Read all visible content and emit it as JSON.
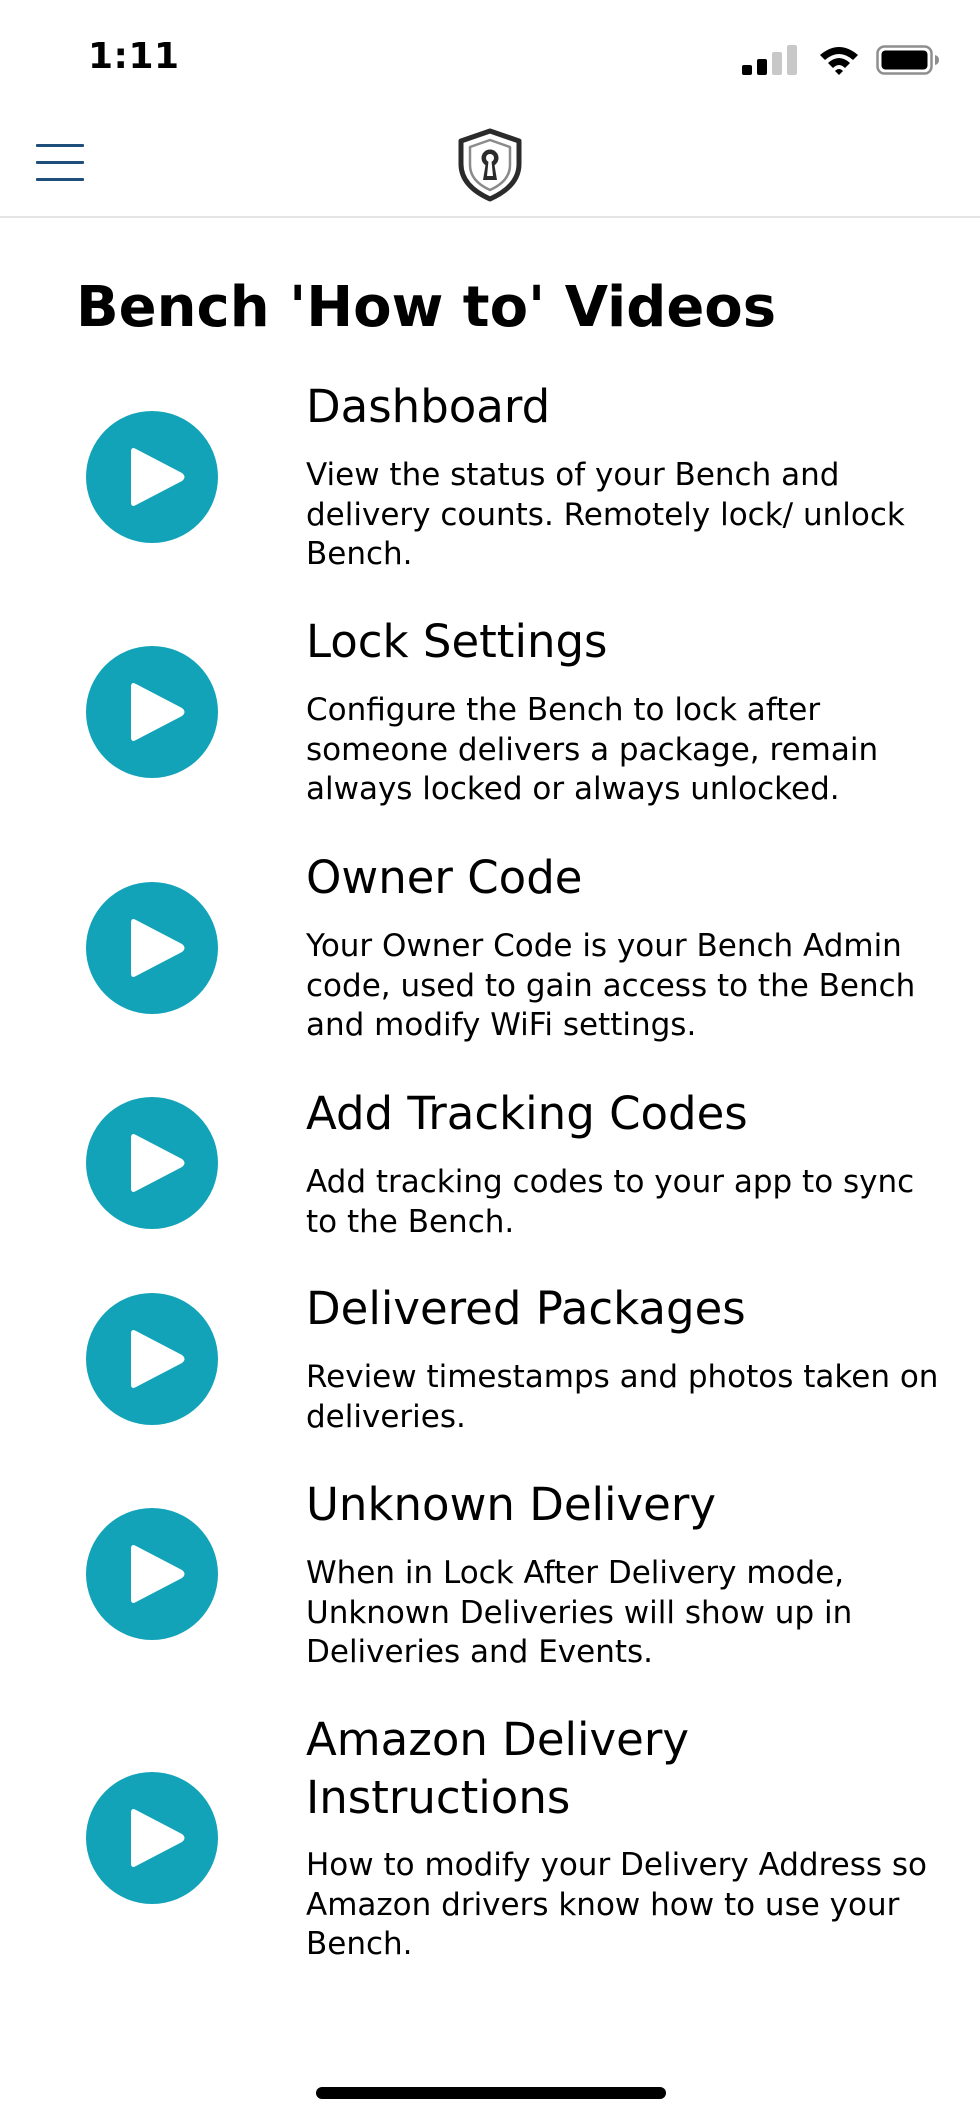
{
  "status_bar": {
    "time": "1:11"
  },
  "header": {
    "menu_icon": "hamburger-menu-icon",
    "logo_icon": "shield-keyhole-logo-icon"
  },
  "page": {
    "title": "Bench 'How to' Videos"
  },
  "colors": {
    "accent": "#12a3b8",
    "menu": "#1d4f7a"
  },
  "videos": [
    {
      "title": "Dashboard",
      "description": "View the status of your Bench and delivery counts. Remotely lock/ unlock Bench."
    },
    {
      "title": "Lock Settings",
      "description": "Configure the Bench to lock after someone delivers a package, remain always locked or always unlocked."
    },
    {
      "title": "Owner Code",
      "description": "Your Owner Code is your Bench Admin code, used to gain access to the Bench and modify WiFi settings."
    },
    {
      "title": "Add Tracking Codes",
      "description": "Add tracking codes to your app to sync to the Bench."
    },
    {
      "title": "Delivered Packages",
      "description": "Review timestamps and photos taken on deliveries."
    },
    {
      "title": "Unknown Delivery",
      "description": "When in Lock After Delivery mode, Unknown Deliveries will show up in Deliveries and Events."
    },
    {
      "title": "Amazon Delivery Instructions",
      "description": "How to modify your Delivery Address so Amazon drivers know how to use your Bench."
    }
  ]
}
